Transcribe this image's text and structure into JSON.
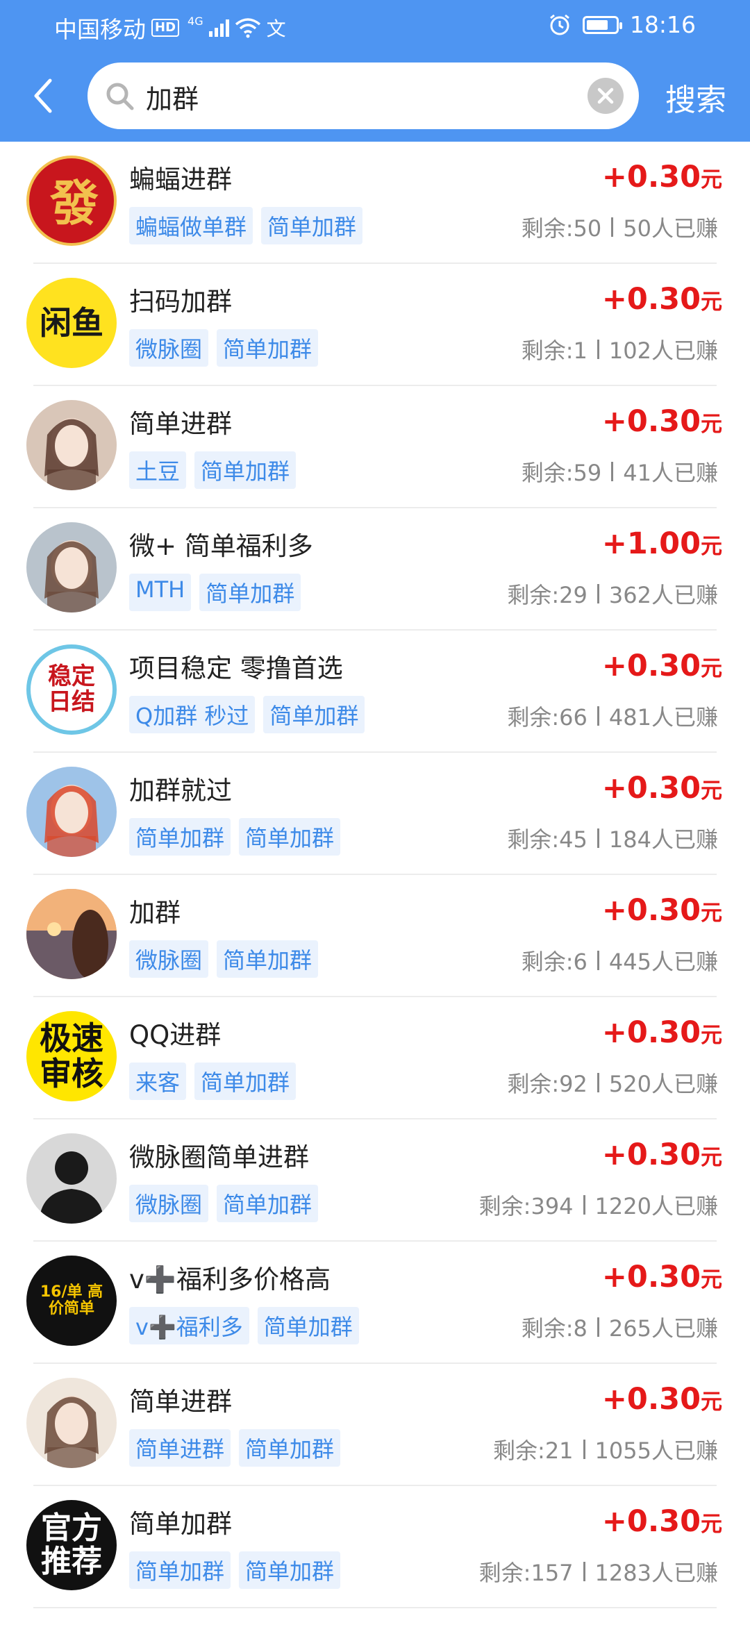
{
  "status_bar": {
    "carrier": "中国移动",
    "hd": "HD",
    "network": "4G",
    "vpn_char": "文",
    "time": "18:16",
    "battery_level": 0.75
  },
  "search": {
    "query": "加群",
    "button_label": "搜索"
  },
  "items": [
    {
      "title": "蝙蝠进群",
      "tags": [
        "蝙蝠做单群",
        "简单加群"
      ],
      "price": "+0.30",
      "unit": "元",
      "remaining": "剩余:50",
      "earned": "50人已赚",
      "avatar_text": "發",
      "avatar_style": "fa",
      "avatar_bg": "#c8161d",
      "avatar_fg": "#f2c14e"
    },
    {
      "title": "扫码加群",
      "tags": [
        "微脉圈",
        "简单加群"
      ],
      "price": "+0.30",
      "unit": "元",
      "remaining": "剩余:1",
      "earned": "102人已赚",
      "avatar_text": "闲鱼",
      "avatar_style": "xianyu",
      "avatar_bg": "#ffe21f",
      "avatar_fg": "#1a1a1a"
    },
    {
      "title": "简单进群",
      "tags": [
        "土豆",
        "简单加群"
      ],
      "price": "+0.30",
      "unit": "元",
      "remaining": "剩余:59",
      "earned": "41人已赚",
      "avatar_text": "",
      "avatar_style": "photo",
      "avatar_bg": "#d9c6b8",
      "avatar_fg": "#5a3a2e"
    },
    {
      "title": "微+ 简单福利多",
      "tags": [
        "MTH",
        "简单加群"
      ],
      "price": "+1.00",
      "unit": "元",
      "remaining": "剩余:29",
      "earned": "362人已赚",
      "avatar_text": "",
      "avatar_style": "photo",
      "avatar_bg": "#b9c3cc",
      "avatar_fg": "#6b4a3a"
    },
    {
      "title": "项目稳定 零撸首选",
      "tags": [
        "Q加群 秒过",
        "简单加群"
      ],
      "price": "+0.30",
      "unit": "元",
      "remaining": "剩余:66",
      "earned": "481人已赚",
      "avatar_text": "稳定日结",
      "avatar_style": "stamp",
      "avatar_bg": "#ffffff",
      "avatar_fg": "#c8161d"
    },
    {
      "title": "加群就过",
      "tags": [
        "简单加群",
        "简单加群"
      ],
      "price": "+0.30",
      "unit": "元",
      "remaining": "剩余:45",
      "earned": "184人已赚",
      "avatar_text": "",
      "avatar_style": "photo",
      "avatar_bg": "#9ec3e8",
      "avatar_fg": "#d9482b"
    },
    {
      "title": "加群",
      "tags": [
        "微脉圈",
        "简单加群"
      ],
      "price": "+0.30",
      "unit": "元",
      "remaining": "剩余:6",
      "earned": "445人已赚",
      "avatar_text": "",
      "avatar_style": "sunset",
      "avatar_bg": "#e89a5e",
      "avatar_fg": "#4a2a1e"
    },
    {
      "title": "QQ进群",
      "tags": [
        "来客",
        "简单加群"
      ],
      "price": "+0.30",
      "unit": "元",
      "remaining": "剩余:92",
      "earned": "520人已赚",
      "avatar_text": "极速审核",
      "avatar_style": "yellow",
      "avatar_bg": "#ffe600",
      "avatar_fg": "#111111"
    },
    {
      "title": "微脉圈简单进群",
      "tags": [
        "微脉圈",
        "简单加群"
      ],
      "price": "+0.30",
      "unit": "元",
      "remaining": "剩余:394",
      "earned": "1220人已赚",
      "avatar_text": "",
      "avatar_style": "silhouette",
      "avatar_bg": "#d8d8d8",
      "avatar_fg": "#1a1a1a"
    },
    {
      "title": "v➕福利多价格高",
      "tags": [
        "v➕福利多",
        "简单加群"
      ],
      "price": "+0.30",
      "unit": "元",
      "remaining": "剩余:8",
      "earned": "265人已赚",
      "avatar_text": "16/单 高价简单",
      "avatar_style": "black",
      "avatar_bg": "#111111",
      "avatar_fg": "#f5c400"
    },
    {
      "title": "简单进群",
      "tags": [
        "简单进群",
        "简单加群"
      ],
      "price": "+0.30",
      "unit": "元",
      "remaining": "剩余:21",
      "earned": "1055人已赚",
      "avatar_text": "",
      "avatar_style": "photo",
      "avatar_bg": "#efe6dc",
      "avatar_fg": "#6b4a3a"
    },
    {
      "title": "简单加群",
      "tags": [
        "简单加群",
        "简单加群"
      ],
      "price": "+0.30",
      "unit": "元",
      "remaining": "剩余:157",
      "earned": "1283人已赚",
      "avatar_text": "官方推荐",
      "avatar_style": "black2",
      "avatar_bg": "#111111",
      "avatar_fg": "#ffffff"
    }
  ],
  "colors": {
    "header": "#4e95f2",
    "price": "#e51919",
    "tag_bg": "#eaf2fd",
    "tag_text": "#3d8ae8"
  }
}
